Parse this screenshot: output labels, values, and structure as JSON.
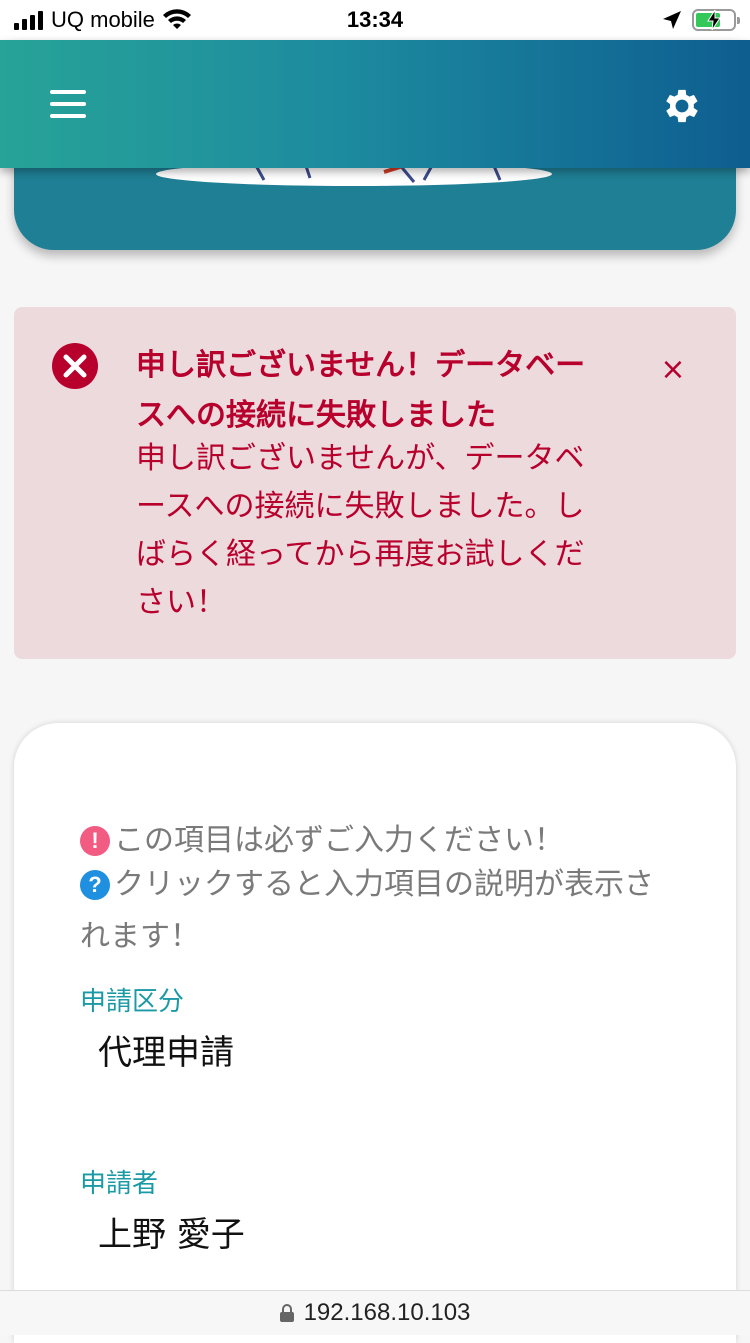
{
  "status_bar": {
    "carrier": "UQ mobile",
    "time": "13:34",
    "icons": [
      "signal-icon",
      "wifi-icon",
      "location-arrow-icon",
      "battery-charging-icon"
    ]
  },
  "app_bar": {
    "menu_icon": "hamburger-menu-icon",
    "settings_icon": "gear-icon",
    "gradient": [
      "#27a398",
      "#0e5e90"
    ]
  },
  "alert": {
    "title": "申し訳ございません！データベースへの接続に失敗しました",
    "message": "申し訳ございませんが、データベースへの接続に失敗しました。しばらく経ってから再度お試しください！",
    "close_label": "×",
    "color": "#b8002d",
    "background": "#eddadd"
  },
  "form": {
    "required_hint": "この項目は必ずご入力ください！",
    "help_hint": "クリックすると入力項目の説明が表示されます！",
    "required_icon_glyph": "!",
    "help_icon_glyph": "?",
    "fields": [
      {
        "label": "申請区分",
        "value": "代理申請"
      },
      {
        "label": "申請者",
        "value": "上野 愛子"
      }
    ]
  },
  "browser": {
    "url": "192.168.10.103",
    "lock_icon": "lock-icon"
  }
}
